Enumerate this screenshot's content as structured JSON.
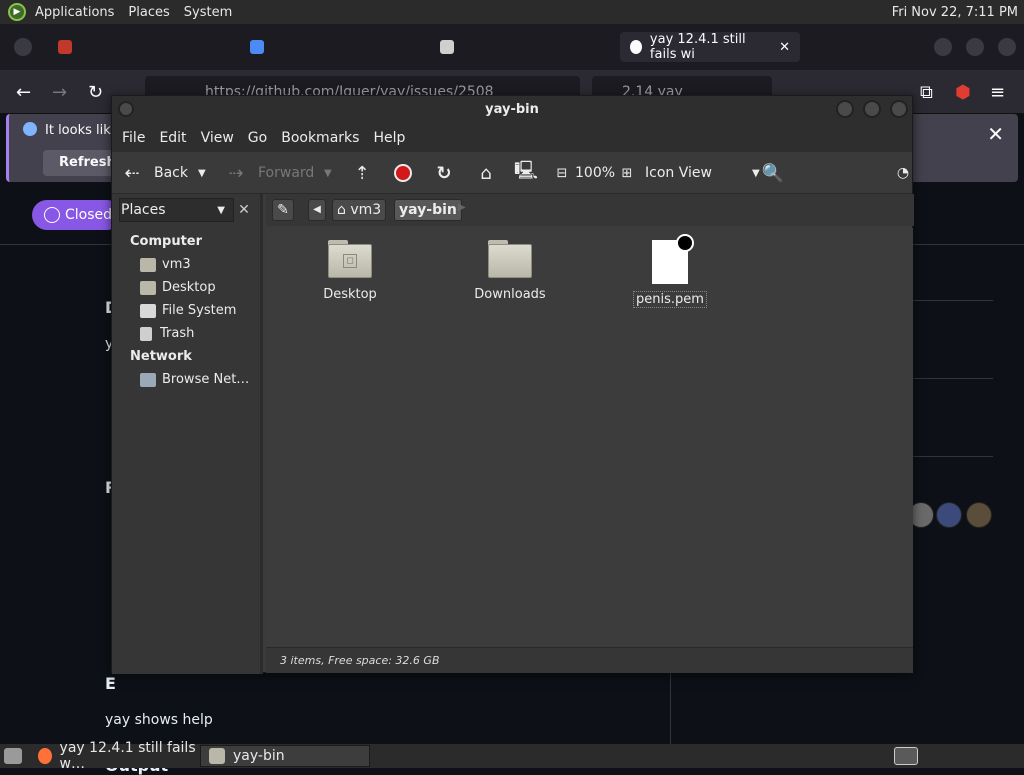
{
  "top_panel": {
    "menus": [
      "Applications",
      "Places",
      "System"
    ],
    "clock": "Fri Nov 22,  7:11 PM"
  },
  "browser": {
    "tabs": [
      {
        "label": "",
        "icon": "gmail-icon"
      },
      {
        "label": "",
        "icon": "drive-icon"
      },
      {
        "label": "",
        "icon": "trash-icon"
      },
      {
        "label": "yay 12.4.1 still fails wi",
        "icon": "github-icon",
        "active": true
      }
    ],
    "url": "https://github.com/Jguer/yay/issues/2508",
    "url_suffix": "2.14 yay",
    "notice_text": "It looks like",
    "notice_button": "Refresh F",
    "issue_state": "Closed",
    "page_text": {
      "heading1": "D",
      "text1": "y",
      "heading2": "R",
      "heading3": "E",
      "body": "yay shows help",
      "heading4": "Output"
    }
  },
  "caja": {
    "title": "yay-bin",
    "menu": [
      "File",
      "Edit",
      "View",
      "Go",
      "Bookmarks",
      "Help"
    ],
    "toolbar": {
      "back": "Back",
      "forward": "Forward",
      "zoom": "100%",
      "view_mode": "Icon View"
    },
    "sidebar": {
      "selector": "Places",
      "sections": [
        {
          "title": "Computer",
          "items": [
            {
              "label": "vm3",
              "icon": "home-icon"
            },
            {
              "label": "Desktop",
              "icon": "desktop-icon"
            },
            {
              "label": "File System",
              "icon": "drive-icon"
            },
            {
              "label": "Trash",
              "icon": "trash-icon"
            }
          ]
        },
        {
          "title": "Network",
          "items": [
            {
              "label": "Browse Net…",
              "icon": "network-icon"
            }
          ]
        }
      ]
    },
    "path": [
      "vm3",
      "yay-bin"
    ],
    "files": [
      {
        "name": "Desktop",
        "type": "folder"
      },
      {
        "name": "Downloads",
        "type": "folder"
      },
      {
        "name": "penis.pem",
        "type": "file"
      }
    ],
    "status": "3 items, Free space: 32.6 GB"
  },
  "taskbar": {
    "tasks": [
      {
        "label": "yay 12.4.1 still fails w…",
        "icon": "firefox-icon"
      },
      {
        "label": "yay-bin",
        "icon": "folder-icon",
        "active": true
      }
    ]
  },
  "colors": {
    "panel": "#2b2b2b",
    "window_bg": "#3c3c3c",
    "closed_badge": "#8957e5",
    "stop_red": "#d21818"
  }
}
